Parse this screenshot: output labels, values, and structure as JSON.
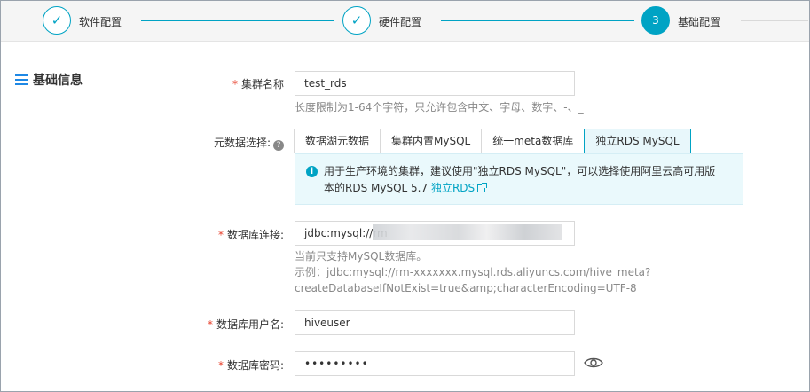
{
  "stepper": {
    "steps": [
      {
        "label": "软件配置",
        "state": "done",
        "glyph": "✓"
      },
      {
        "label": "硬件配置",
        "state": "done",
        "glyph": "✓"
      },
      {
        "label": "基础配置",
        "state": "active",
        "glyph": "3"
      }
    ]
  },
  "section": {
    "title": "基础信息"
  },
  "cluster_name": {
    "label": "集群名称",
    "value": "test_rds",
    "hint": "长度限制为1-64个字符，只允许包含中文、字母、数字、-、_"
  },
  "metadata": {
    "label": "元数据选择:",
    "help_glyph": "?",
    "tabs": [
      "数据湖元数据",
      "集群内置MySQL",
      "统一meta数据库",
      "独立RDS MySQL"
    ],
    "selected": "独立RDS MySQL",
    "notice_line1": "用于生产环境的集群，建议使用\"独立RDS MySQL\"，可以选择使用阿里云高可用版",
    "notice_line2": "本的RDS MySQL 5.7",
    "notice_link": "独立RDS",
    "info_glyph": "i"
  },
  "db_connection": {
    "label": "数据库连接:",
    "value": "jdbc:mysql://rm",
    "hint_line1": "当前只支持MySQL数据库。",
    "hint_line2": "示例：jdbc:mysql://rm-xxxxxxx.mysql.rds.aliyuncs.com/hive_meta?",
    "hint_line3": "createDatabaseIfNotExist=true&amp;characterEncoding=UTF-8"
  },
  "db_user": {
    "label": "数据库用户名:",
    "value": "hiveuser"
  },
  "db_password": {
    "label": "数据库密码:",
    "value": "•••••••••"
  },
  "required_mark": "*",
  "colors": {
    "accent": "#00a3c4",
    "required": "#e8402c"
  }
}
